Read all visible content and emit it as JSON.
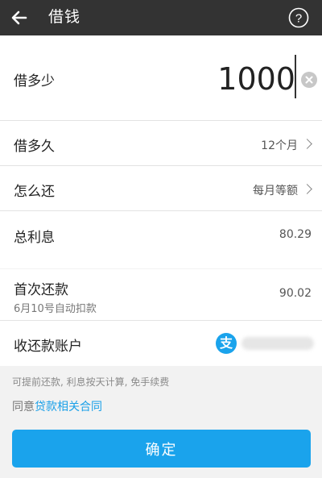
{
  "header": {
    "title": "借钱",
    "back_icon": "arrow-left-icon",
    "help_icon": "question-circle-icon"
  },
  "amount": {
    "label": "借多少",
    "value": "1000"
  },
  "term": {
    "label": "借多久",
    "value": "12个月"
  },
  "repayment": {
    "label": "怎么还",
    "value": "每月等额"
  },
  "interest": {
    "label": "总利息",
    "value": "80.29"
  },
  "first_payment": {
    "label": "首次还款",
    "sublabel": "6月10号自动扣款",
    "value": "90.02"
  },
  "account": {
    "label": "收还款账户",
    "icon_glyph": "支"
  },
  "note": "可提前还款, 利息按天计算, 免手续费",
  "agreement": {
    "prefix": "同意",
    "link": "贷款相关合同"
  },
  "confirm_label": "确定",
  "colors": {
    "accent": "#1aa3ec",
    "topbar": "#333333"
  }
}
